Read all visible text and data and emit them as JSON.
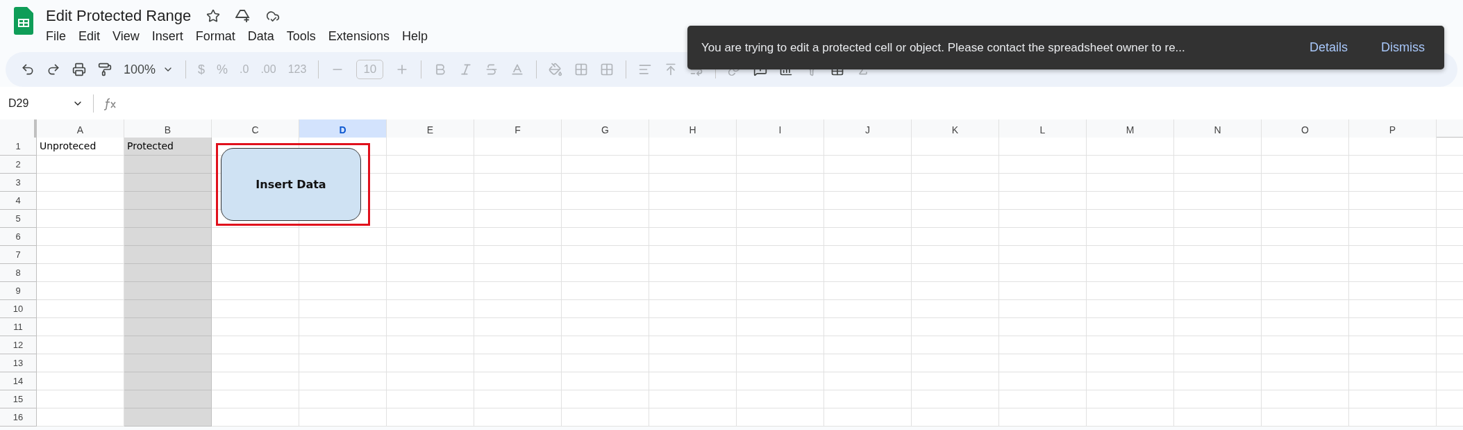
{
  "document": {
    "title": "Edit Protected Range"
  },
  "menu": [
    "File",
    "Edit",
    "View",
    "Insert",
    "Format",
    "Data",
    "Tools",
    "Extensions",
    "Help"
  ],
  "toolbar": {
    "zoom": "100%",
    "currency": "$",
    "percent": "%",
    "decimal_decrease": ".0",
    "decimal_increase": ".00",
    "number_format": "123",
    "font_size": "10"
  },
  "formula_bar": {
    "name_box": "D29"
  },
  "columns": [
    {
      "label": "A",
      "selected": false,
      "protected": false
    },
    {
      "label": "B",
      "selected": false,
      "protected": true
    },
    {
      "label": "C",
      "selected": false,
      "protected": false
    },
    {
      "label": "D",
      "selected": true,
      "protected": false
    },
    {
      "label": "E",
      "selected": false,
      "protected": false
    },
    {
      "label": "F",
      "selected": false,
      "protected": false
    },
    {
      "label": "G",
      "selected": false,
      "protected": false
    },
    {
      "label": "H",
      "selected": false,
      "protected": false
    },
    {
      "label": "I",
      "selected": false,
      "protected": false
    },
    {
      "label": "J",
      "selected": false,
      "protected": false
    },
    {
      "label": "K",
      "selected": false,
      "protected": false
    },
    {
      "label": "L",
      "selected": false,
      "protected": false
    },
    {
      "label": "M",
      "selected": false,
      "protected": false
    },
    {
      "label": "N",
      "selected": false,
      "protected": false
    },
    {
      "label": "O",
      "selected": false,
      "protected": false
    },
    {
      "label": "P",
      "selected": false,
      "protected": false
    }
  ],
  "rows": [
    {
      "label": "1",
      "cells": [
        "Unproteced",
        "Protected"
      ]
    },
    {
      "label": "2"
    },
    {
      "label": "3"
    },
    {
      "label": "4"
    },
    {
      "label": "5"
    },
    {
      "label": "6"
    },
    {
      "label": "7"
    },
    {
      "label": "8"
    },
    {
      "label": "9"
    },
    {
      "label": "10"
    },
    {
      "label": "11"
    },
    {
      "label": "12"
    },
    {
      "label": "13"
    },
    {
      "label": "14"
    },
    {
      "label": "15"
    },
    {
      "label": "16"
    }
  ],
  "shape": {
    "text": "Insert Data",
    "selected": true
  },
  "toast": {
    "message": "You are trying to edit a protected cell or object. Please contact the spreadsheet owner to re...",
    "actions": [
      "Details",
      "Dismiss"
    ]
  }
}
